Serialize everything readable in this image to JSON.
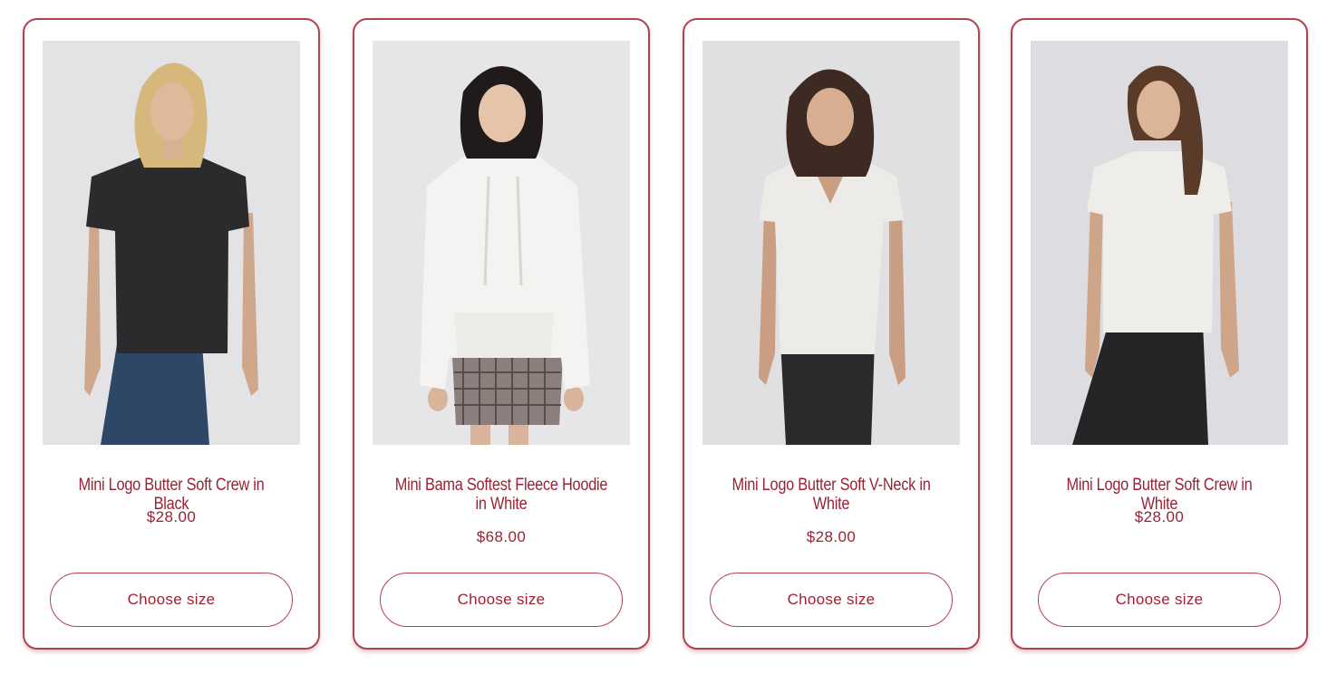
{
  "products": [
    {
      "title": "Mini Logo Butter Soft Crew in Black",
      "price": "$28.00",
      "button_label": "Choose size"
    },
    {
      "title": "Mini Bama Softest Fleece Hoodie in White",
      "price": "$68.00",
      "button_label": "Choose size"
    },
    {
      "title": "Mini Logo Butter Soft V-Neck in White",
      "price": "$28.00",
      "button_label": "Choose size"
    },
    {
      "title": "Mini Logo Butter Soft Crew in White",
      "price": "$28.00",
      "button_label": "Choose size"
    }
  ],
  "colors": {
    "accent": "#9b2233",
    "card_border": "#b3424f",
    "photo_background": "#e2e1e4"
  }
}
